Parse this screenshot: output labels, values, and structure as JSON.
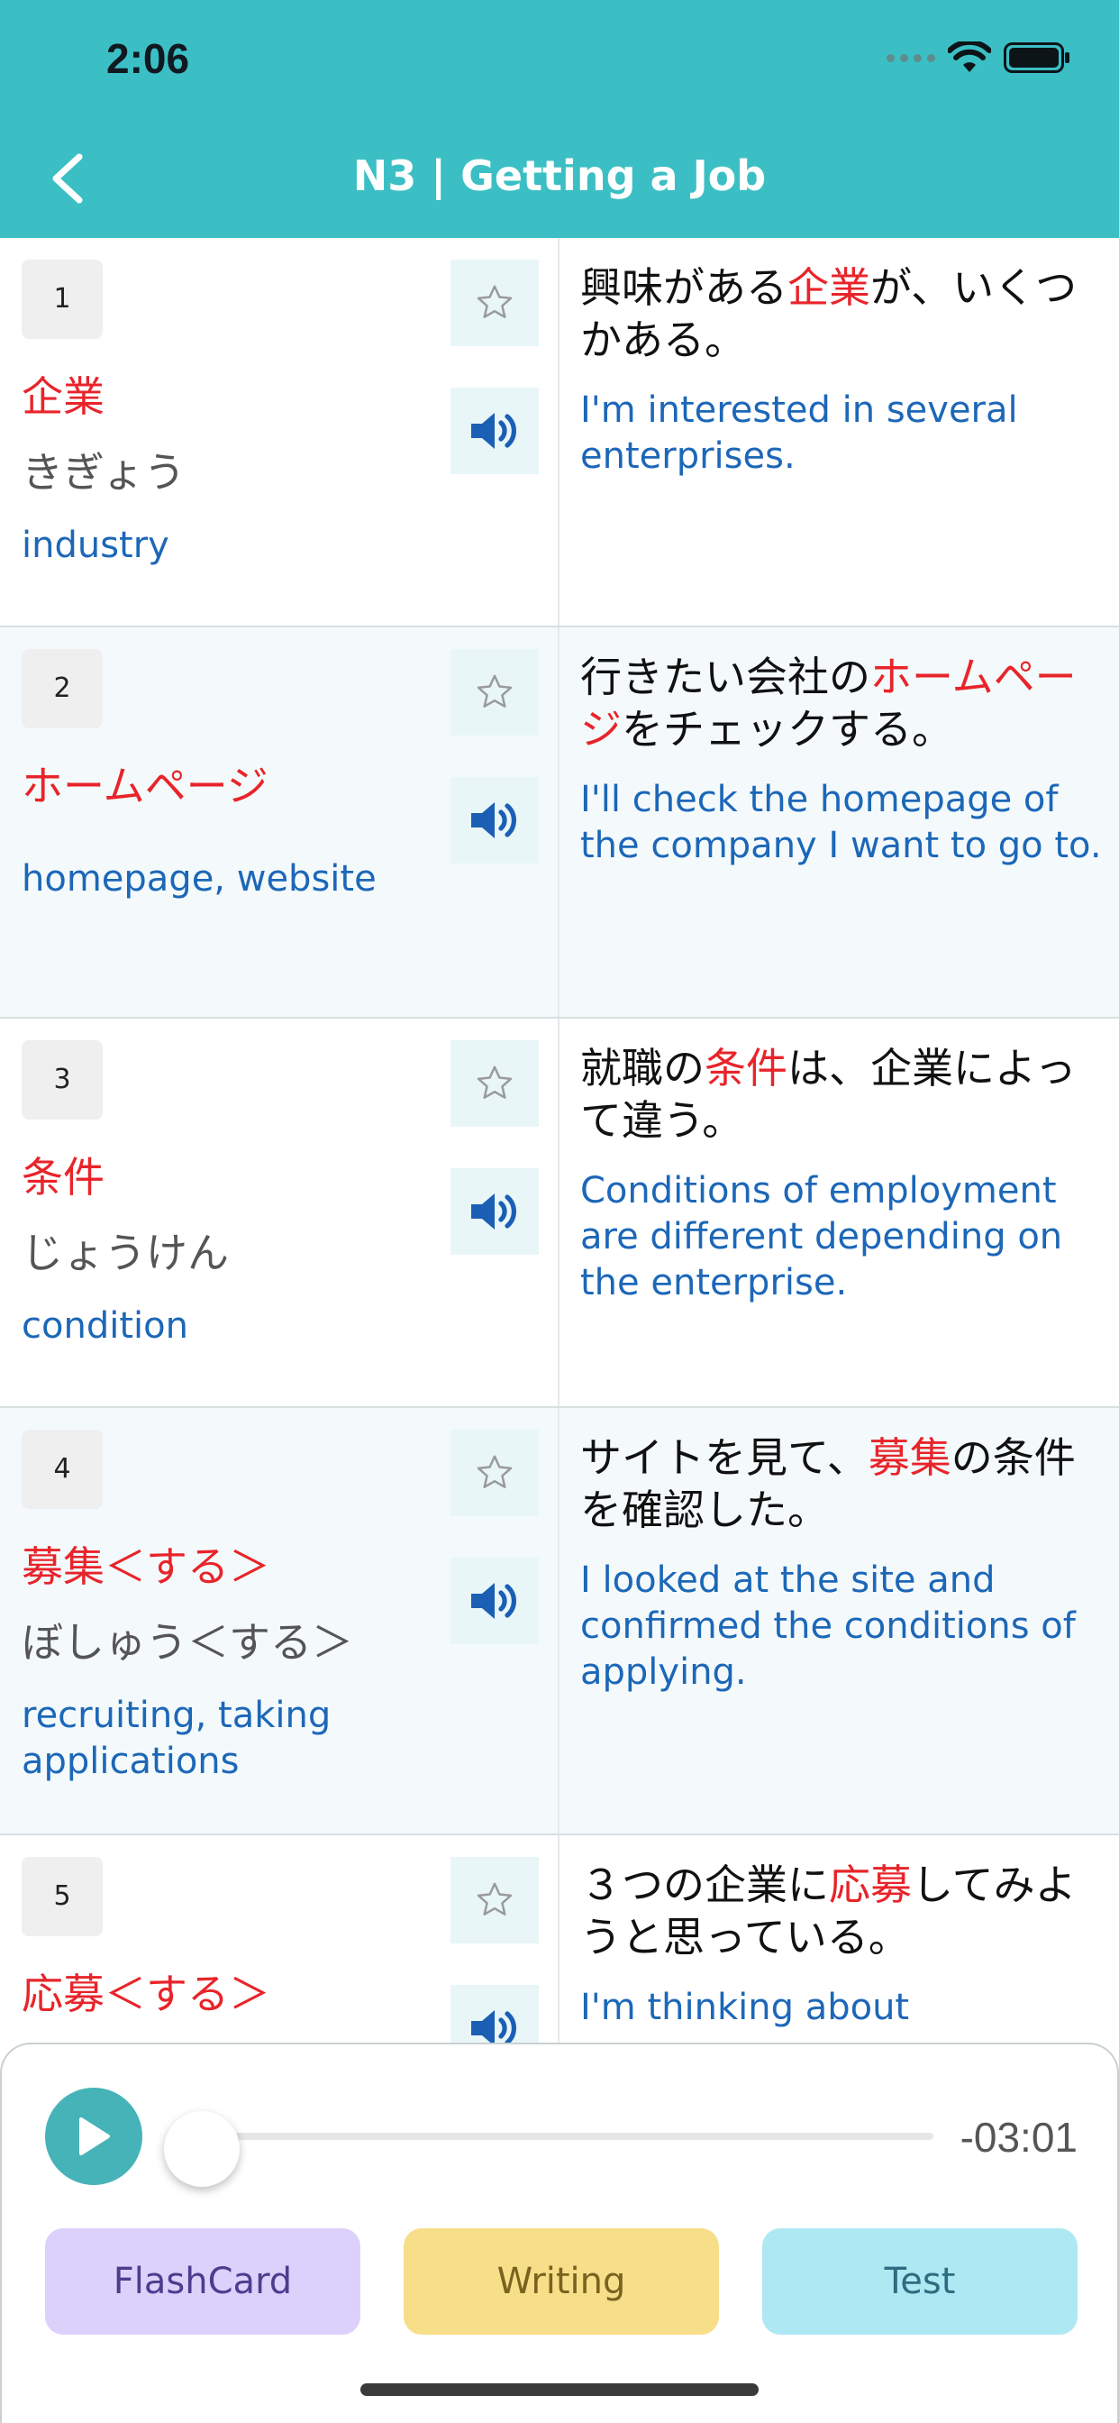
{
  "status": {
    "time": "2:06"
  },
  "header": {
    "title": "N3 | Getting a Job",
    "back_icon": "chevron-left-icon"
  },
  "colors": {
    "header_bg": "#3bbfc4",
    "highlight": "#e8242a",
    "english": "#1c67b8"
  },
  "words": [
    {
      "num": "1",
      "kanji": "企業",
      "reading": "きぎょう",
      "meaning": "industry",
      "jp_before": "興味がある",
      "jp_hl": "企業",
      "jp_after": "が、いくつかある。",
      "en": "I'm interested in several enterprises."
    },
    {
      "num": "2",
      "kanji": "ホームページ",
      "reading": "",
      "meaning": "homepage, website",
      "jp_before": "行きたい会社の",
      "jp_hl": "ホームページ",
      "jp_after": "をチェックする。",
      "en": "I'll check the homepage of the company I want to go to."
    },
    {
      "num": "3",
      "kanji": "条件",
      "reading": "じょうけん",
      "meaning": "condition",
      "jp_before": "就職の",
      "jp_hl": "条件",
      "jp_after": "は、企業によって違う。",
      "en": "Conditions of employment are different depending on the enterprise."
    },
    {
      "num": "4",
      "kanji": "募集＜する＞",
      "reading": "ぼしゅう＜する＞",
      "meaning": "recruiting, taking applications",
      "jp_before": "サイトを見て、",
      "jp_hl": "募集",
      "jp_after": "の条件を確認した。",
      "en": "I looked at the site and confirmed the conditions of applying."
    },
    {
      "num": "5",
      "kanji": "応募＜する＞",
      "reading": "",
      "meaning": "",
      "jp_before": "３つの企業に",
      "jp_hl": "応募",
      "jp_after": "してみようと思っている。",
      "en": "I'm thinking about"
    }
  ],
  "player": {
    "time_remaining": "-03:01",
    "progress": 0.0
  },
  "modes": {
    "flashcard": "FlashCard",
    "writing": "Writing",
    "test": "Test"
  }
}
